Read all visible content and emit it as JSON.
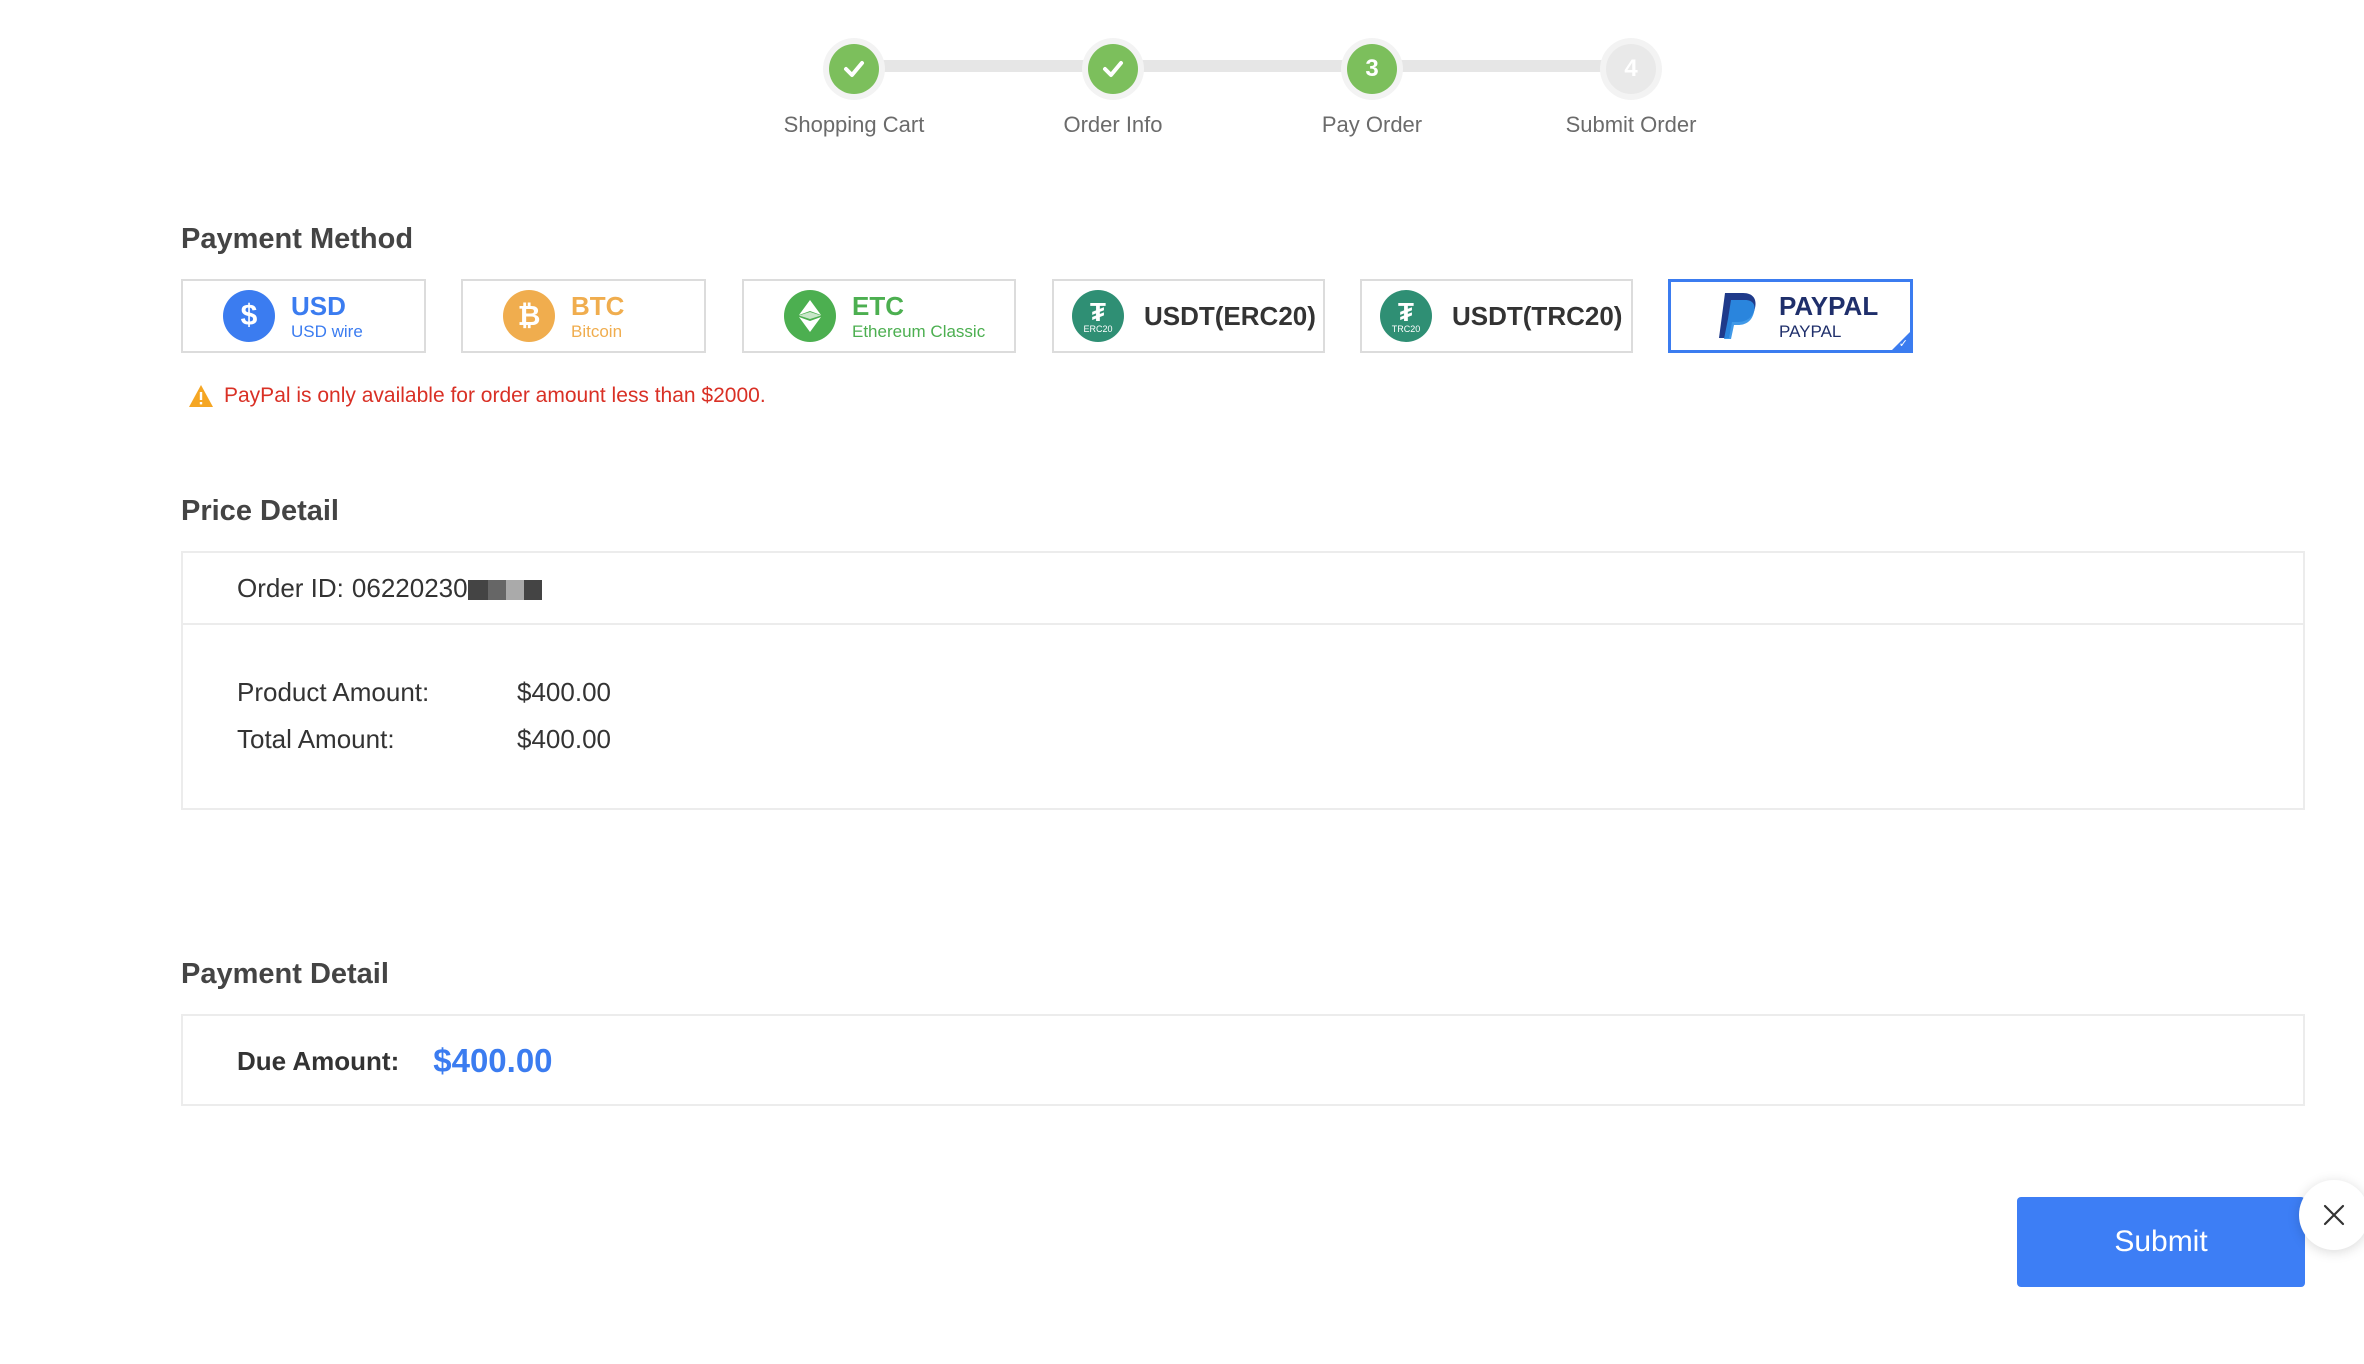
{
  "stepper": {
    "steps": [
      {
        "label": "Shopping Cart",
        "state": "done",
        "marker": "✓"
      },
      {
        "label": "Order Info",
        "state": "done",
        "marker": "✓"
      },
      {
        "label": "Pay Order",
        "state": "active",
        "marker": "3"
      },
      {
        "label": "Submit Order",
        "state": "pending",
        "marker": "4"
      }
    ]
  },
  "payment_method": {
    "title": "Payment Method",
    "options": [
      {
        "name": "USD",
        "sub": "USD wire",
        "icon": "dollar-icon",
        "color": "#3b7cf0",
        "selected": false
      },
      {
        "name": "BTC",
        "sub": "Bitcoin",
        "icon": "bitcoin-icon",
        "color": "#f0ad4e",
        "selected": false
      },
      {
        "name": "ETC",
        "sub": "Ethereum Classic",
        "icon": "ethereum-classic-icon",
        "color": "#4caf50",
        "selected": false
      },
      {
        "name": "USDT(ERC20)",
        "badge": "ERC20",
        "icon": "tether-icon",
        "color": "#2f8f74",
        "selected": false
      },
      {
        "name": "USDT(TRC20)",
        "badge": "TRC20",
        "icon": "tether-icon",
        "color": "#2f8f74",
        "selected": false
      },
      {
        "name": "PAYPAL",
        "sub": "PAYPAL",
        "icon": "paypal-icon",
        "color": "#1f2f6b",
        "selected": true
      }
    ],
    "warning": "PayPal is only available for order amount less than $2000."
  },
  "price_detail": {
    "title": "Price Detail",
    "order_id_label": "Order ID:",
    "order_id_value": "06220230",
    "product_amount_label": "Product Amount:",
    "product_amount": "$400.00",
    "total_amount_label": "Total Amount:",
    "total_amount": "$400.00"
  },
  "payment_detail": {
    "title": "Payment Detail",
    "due_label": "Due Amount:",
    "due_amount": "$400.00"
  },
  "submit_label": "Submit",
  "colors": {
    "accent": "#3d7ef5",
    "success": "#7cbf5c",
    "warning": "#d93025"
  }
}
